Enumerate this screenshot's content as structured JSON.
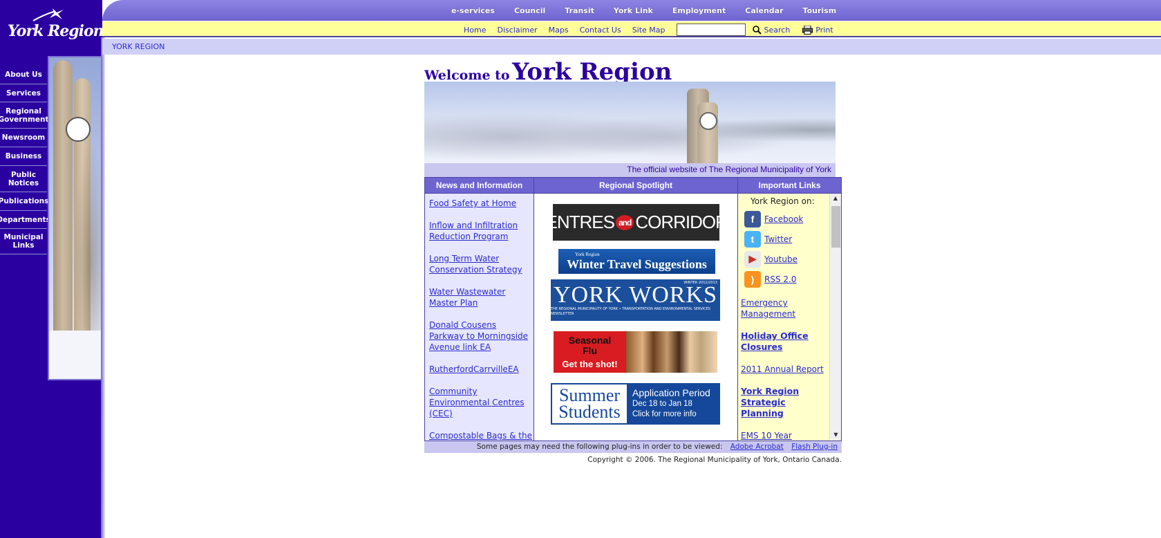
{
  "sidebar": {
    "logo_text": "York Region",
    "nav": [
      {
        "label": "About Us",
        "id": "about-us",
        "h": 27
      },
      {
        "label": "Services",
        "id": "services",
        "h": 26
      },
      {
        "label": "Regional Government",
        "id": "regional-government",
        "h": 38
      },
      {
        "label": "Newsroom",
        "id": "newsroom",
        "h": 27
      },
      {
        "label": "Business",
        "id": "business",
        "h": 27
      },
      {
        "label": "Public Notices",
        "id": "public-notices",
        "h": 38
      },
      {
        "label": "Publications",
        "id": "publications",
        "h": 27
      },
      {
        "label": "Departments",
        "id": "departments",
        "h": 26
      },
      {
        "label": "Municipal Links",
        "id": "municipal-links",
        "h": 37
      }
    ]
  },
  "header": {
    "topnav": [
      "e-services",
      "Council",
      "Transit",
      "York Link",
      "Employment",
      "Calendar",
      "Tourism"
    ],
    "utility": [
      "Home",
      "Disclaimer",
      "Maps",
      "Contact Us",
      "Site Map"
    ],
    "search_label": "Search",
    "print_label": "Print",
    "search_value": ""
  },
  "breadcrumb": "YORK REGION",
  "hero": {
    "welcome_small": "Welcome to",
    "welcome_big": "York Region",
    "tagline": "The official website of The Regional Municipality of York"
  },
  "columns": {
    "news_title": "News and Information",
    "spotlight_title": "Regional Spotlight",
    "links_title": "Important Links"
  },
  "news": [
    "Food Safety at Home",
    "Inflow and Infiltration Reduction Program",
    "Long Term Water Conservation Strategy",
    "Water Wastewater Master Plan",
    "Donald Cousens Parkway to Morningside Avenue link EA",
    "RutherfordCarrvilleEA",
    "Community Environmental Centres (CEC)",
    "Compostable Bags & the Green Bin"
  ],
  "spotlight": {
    "cc_left": "CENTRES",
    "cc_and": "and",
    "cc_right": "CORRIDORS",
    "wts_small": "York Region",
    "wts_title": "Winter Travel Suggestions",
    "yw_title": "YORK WORKS",
    "yw_sub": "THE REGIONAL MUNICIPALITY OF YORK • TRANSPORTATION AND ENVIRONMENTAL SERVICES NEWSLETTER",
    "yw_issue": "WINTER 2012/2013",
    "flu_line1": "Seasonal",
    "flu_line2": "Flu",
    "flu_line3": "Get the shot!",
    "ss_line1": "Summer",
    "ss_line2": "Students",
    "ss_a": "Application Period",
    "ss_b": "Dec 18 to Jan 18",
    "ss_c": "Click for more info"
  },
  "links": {
    "social_heading": "York Region on:",
    "social": [
      {
        "label": "Facebook",
        "icon": "facebook-icon",
        "color": "#3b5998",
        "glyph": "f"
      },
      {
        "label": "Twitter",
        "icon": "twitter-icon",
        "color": "#4ab3f4",
        "glyph": "t"
      },
      {
        "label": "Youtube",
        "icon": "youtube-icon",
        "color": "#e8e8e8",
        "glyph": "▶"
      },
      {
        "label": "RSS 2.0",
        "icon": "rss-icon",
        "color": "#f7931e",
        "glyph": ")"
      }
    ],
    "items": [
      {
        "label": "Emergency Management",
        "bold": false
      },
      {
        "label": "Holiday Office Closures",
        "bold": true
      },
      {
        "label": "2011 Annual Report",
        "bold": false
      },
      {
        "label": "York Region Strategic Planning",
        "bold": true
      },
      {
        "label": "EMS 10 Year",
        "bold": false
      }
    ]
  },
  "footer": {
    "plugins_text": "Some pages may need the following plug-ins in order to be viewed:",
    "plugin_1": "Adobe Acrobat",
    "plugin_2": "Flash Plug-in",
    "copyright": "Copyright © 2006. The Regional Municipality of York, Ontario Canada."
  }
}
